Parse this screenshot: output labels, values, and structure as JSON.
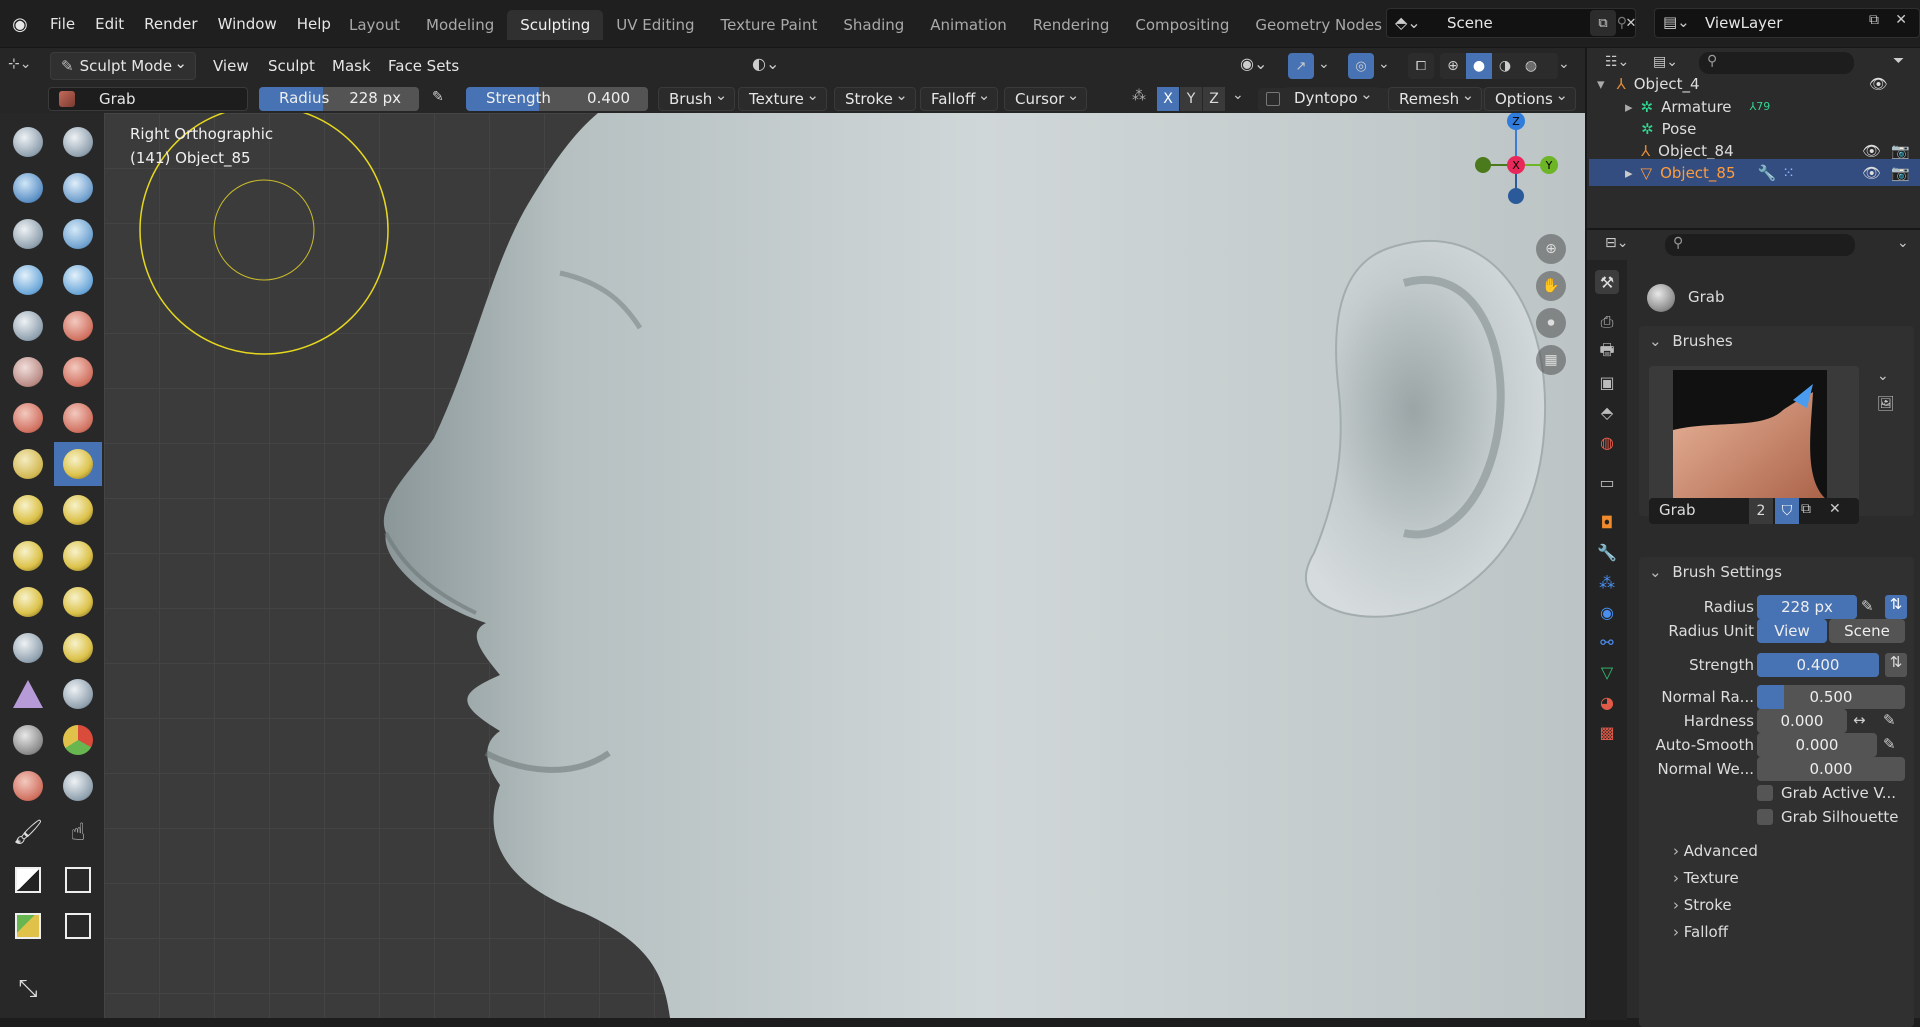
{
  "menu": [
    "File",
    "Edit",
    "Render",
    "Window",
    "Help"
  ],
  "workspaces": [
    {
      "label": "Layout",
      "active": false
    },
    {
      "label": "Modeling",
      "active": false
    },
    {
      "label": "Sculpting",
      "active": true
    },
    {
      "label": "UV Editing",
      "active": false
    },
    {
      "label": "Texture Paint",
      "active": false
    },
    {
      "label": "Shading",
      "active": false
    },
    {
      "label": "Animation",
      "active": false
    },
    {
      "label": "Rendering",
      "active": false
    },
    {
      "label": "Compositing",
      "active": false
    },
    {
      "label": "Geometry Nodes",
      "active": false
    }
  ],
  "scene": "Scene",
  "view_layer": "ViewLayer",
  "header": {
    "mode": "Sculpt Mode",
    "menus": [
      "View",
      "Sculpt",
      "Mask",
      "Face Sets"
    ]
  },
  "tool_header": {
    "brush": "Grab",
    "radius_label": "Radius",
    "radius_value": "228 px",
    "radius_fill": 0.45,
    "strength_label": "Strength",
    "strength_value": "0.400",
    "strength_fill": 0.4,
    "dropdowns": [
      "Brush",
      "Texture",
      "Stroke",
      "Falloff",
      "Cursor"
    ],
    "axes": [
      "X",
      "Y",
      "Z"
    ],
    "dyntopo": "Dyntopo",
    "remesh": "Remesh",
    "options": "Options"
  },
  "viewport": {
    "view_name": "Right Orthographic",
    "object_info": "(141) Object_85",
    "gizmo": {
      "x": "X",
      "y": "Y",
      "z": "Z"
    }
  },
  "outliner": {
    "rows": [
      {
        "label": "Object_4",
        "indent": 0,
        "selected": false
      },
      {
        "label": "Armature",
        "indent": 1,
        "selected": false,
        "badge": "79"
      },
      {
        "label": "Pose",
        "indent": 1,
        "selected": false
      },
      {
        "label": "Object_84",
        "indent": 1,
        "selected": false
      },
      {
        "label": "Object_85",
        "indent": 1,
        "selected": true
      }
    ]
  },
  "properties": {
    "tool_name": "Grab",
    "brushes_title": "Brushes",
    "brush_name": "Grab",
    "brush_users": "2",
    "settings_title": "Brush Settings",
    "rows": [
      {
        "label": "Radius",
        "value": "228 px",
        "fill": 1.0
      },
      {
        "label": "Strength",
        "value": "0.400",
        "fill": 1.0
      },
      {
        "label": "Normal Ra...",
        "value": "0.500",
        "fill": 0.15
      },
      {
        "label": "Hardness",
        "value": "0.000",
        "fill": 0
      },
      {
        "label": "Auto-Smooth",
        "value": "0.000",
        "fill": 0
      },
      {
        "label": "Normal We...",
        "value": "0.000",
        "fill": 0
      }
    ],
    "radius_unit_label": "Radius Unit",
    "radius_unit_options": [
      "View",
      "Scene"
    ],
    "checkboxes": [
      "Grab Active V...",
      "Grab Silhouette"
    ],
    "subpanels": [
      "Advanced",
      "Texture",
      "Stroke",
      "Falloff"
    ]
  },
  "colors": {
    "accent": "#4772b3",
    "selected_object": "#ff9c3a",
    "cursor_circle": "#e6d81e"
  }
}
